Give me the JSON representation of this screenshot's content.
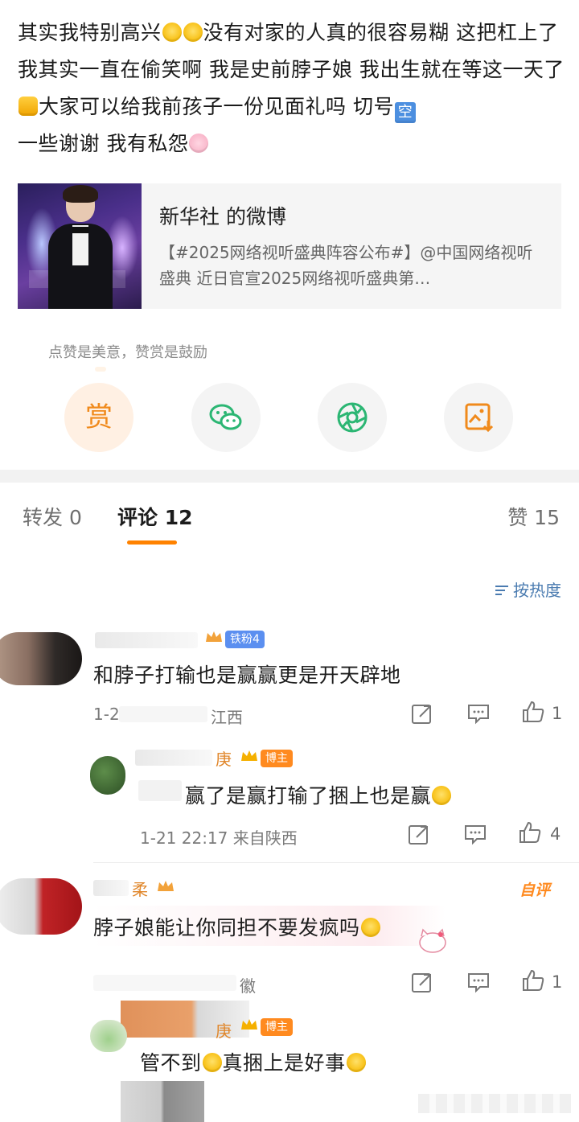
{
  "post": {
    "text_parts": [
      "其实我特别高兴",
      "没有对家的人真的很容易糊 这把杠上了我其实一直在偷笑啊 我是史前脖子娘 我出生就在等这一天了",
      "大家可以给我前孩子一份见面礼吗 切号",
      "一些谢谢 我有私怨"
    ],
    "emoji": {
      "laugh": "laugh-emoji",
      "fist": "fist-emoji",
      "kong": "空",
      "pig": "pig-emoji"
    }
  },
  "repost_card": {
    "title": "新华社 的微博",
    "desc": "【#2025网络视听盛典阵容公布#】@中国网络视听盛典 近日官宣2025网络视听盛典第…"
  },
  "reward": {
    "caption": "点赞是美意，赞赏是鼓励",
    "reward_label": "赏",
    "icons": [
      "wechat-icon",
      "moments-icon",
      "save-image-icon"
    ]
  },
  "tabs": {
    "repost": "转发 0",
    "comment": "评论 12",
    "like": "赞 15"
  },
  "sort": {
    "label": "按热度"
  },
  "comments": [
    {
      "badge": "铁粉4",
      "text": "和脖子打输也是赢赢更是开天辟地",
      "meta_left": "1-2",
      "meta_loc": "江西",
      "likes": "1"
    },
    {
      "name_suffix": "庚",
      "badge": "博主",
      "text": "赢了是赢打输了捆上也是赢",
      "meta": "1-21 22:17  来自陕西",
      "likes": "4"
    },
    {
      "name_suffix": "柔",
      "tag": "自评",
      "text": "脖子娘能让你同担不要发疯吗",
      "meta_loc": "徽",
      "likes": "1"
    },
    {
      "name_suffix": "庚",
      "badge": "博主",
      "text_parts": [
        "管不到",
        "真捆上是好事"
      ]
    }
  ],
  "colors": {
    "accent": "#ff8200",
    "link": "#4a7bb0",
    "badge_fan": "#5b8ff0",
    "badge_owner": "#ff8a1f"
  }
}
